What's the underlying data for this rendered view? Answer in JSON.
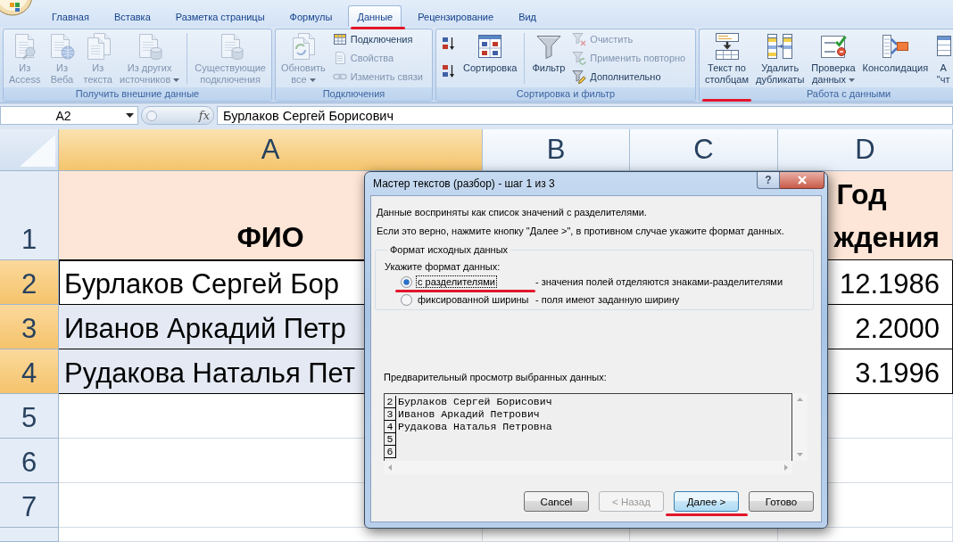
{
  "tabs": [
    {
      "label": "Главная",
      "selected": false,
      "marked": false
    },
    {
      "label": "Вставка",
      "selected": false,
      "marked": false
    },
    {
      "label": "Разметка страницы",
      "selected": false,
      "marked": false
    },
    {
      "label": "Формулы",
      "selected": false,
      "marked": false
    },
    {
      "label": "Данные",
      "selected": true,
      "marked": true
    },
    {
      "label": "Рецензирование",
      "selected": false,
      "marked": false
    },
    {
      "label": "Вид",
      "selected": false,
      "marked": false
    }
  ],
  "ribbon_groups": [
    {
      "title": "Получить внешние данные",
      "items": [
        {
          "kind": "large",
          "label": [
            "Из",
            "Access"
          ],
          "disabled": true,
          "dropdown": false,
          "marked": false
        },
        {
          "kind": "large",
          "label": [
            "Из",
            "Веба"
          ],
          "disabled": true,
          "dropdown": false,
          "marked": false
        },
        {
          "kind": "large",
          "label": [
            "Из",
            "текста"
          ],
          "disabled": true,
          "dropdown": false,
          "marked": false
        },
        {
          "kind": "large",
          "label": [
            "Из других",
            "источников"
          ],
          "disabled": true,
          "dropdown": true,
          "marked": false
        },
        {
          "kind": "separator"
        },
        {
          "kind": "large",
          "label": [
            "Существующие",
            "подключения"
          ],
          "disabled": true,
          "dropdown": false,
          "marked": false
        }
      ]
    },
    {
      "title": "Подключения",
      "items": [
        {
          "kind": "large",
          "label": [
            "Обновить",
            "все"
          ],
          "disabled": true,
          "dropdown": true,
          "marked": false
        },
        {
          "kind": "small",
          "label": [
            "Подключения"
          ],
          "disabled": false,
          "dropdown": false,
          "marked": false
        },
        {
          "kind": "small",
          "label": [
            "Свойства"
          ],
          "disabled": true,
          "dropdown": false,
          "marked": false
        },
        {
          "kind": "small",
          "label": [
            "Изменить связи"
          ],
          "disabled": true,
          "dropdown": false,
          "marked": false
        }
      ]
    },
    {
      "title": "Сортировка и фильтр",
      "items": [
        {
          "kind": "small",
          "disabled": false,
          "dropdown": false,
          "marked": false
        },
        {
          "kind": "small",
          "disabled": false,
          "dropdown": false,
          "marked": false
        },
        {
          "kind": "large",
          "label": [
            "Сортировка"
          ],
          "disabled": false,
          "dropdown": false,
          "marked": false
        },
        {
          "kind": "separator"
        },
        {
          "kind": "large",
          "label": [
            "Фильтр"
          ],
          "disabled": false,
          "dropdown": false,
          "marked": false
        },
        {
          "kind": "small",
          "label": [
            "Очистить"
          ],
          "disabled": true,
          "dropdown": false,
          "marked": false
        },
        {
          "kind": "small",
          "label": [
            "Применить повторно"
          ],
          "disabled": true,
          "dropdown": false,
          "marked": false
        },
        {
          "kind": "small",
          "label": [
            "Дополнительно"
          ],
          "disabled": false,
          "dropdown": false,
          "marked": false
        }
      ]
    },
    {
      "title": "Работа с данными",
      "items": [
        {
          "kind": "large",
          "label": [
            "Текст по",
            "столбцам"
          ],
          "disabled": false,
          "dropdown": false,
          "marked": true
        },
        {
          "kind": "large",
          "label": [
            "Удалить",
            "дубликаты"
          ],
          "disabled": false,
          "dropdown": false,
          "marked": false
        },
        {
          "kind": "large",
          "label": [
            "Проверка",
            "данных"
          ],
          "disabled": false,
          "dropdown": true,
          "marked": false
        },
        {
          "kind": "large",
          "label": [
            "Консолидация"
          ],
          "disabled": false,
          "dropdown": false,
          "marked": false
        },
        {
          "kind": "large",
          "label": [
            "А",
            "\"чт"
          ],
          "disabled": false,
          "dropdown": false,
          "marked": false
        }
      ]
    }
  ],
  "formula_bar": {
    "cell_ref": "A2",
    "function_button": "fx",
    "value": "Бурлаков Сергей Борисович"
  },
  "sheet": {
    "columns": [
      {
        "label": "A",
        "selected": true
      },
      {
        "label": "B",
        "selected": false
      },
      {
        "label": "C",
        "selected": false
      },
      {
        "label": "D",
        "selected": false
      }
    ],
    "rows": [
      {
        "label": "1",
        "selected": false,
        "kind": "header",
        "cells": [
          {
            "lines": [
              "ФИО"
            ],
            "selected": false,
            "active": false
          },
          null,
          null,
          {
            "lines": [
              "Год",
              "ждения"
            ],
            "selected": false,
            "active": false
          }
        ]
      },
      {
        "label": "2",
        "selected": true,
        "kind": "data",
        "cells": [
          {
            "lines": [
              "Бурлаков Сергей Бор"
            ],
            "selected": false,
            "active": true
          },
          null,
          null,
          {
            "lines": [
              "12.1986"
            ],
            "selected": false,
            "active": false
          }
        ]
      },
      {
        "label": "3",
        "selected": true,
        "kind": "data",
        "cells": [
          {
            "lines": [
              "Иванов Аркадий Петр"
            ],
            "selected": true,
            "active": false
          },
          null,
          null,
          {
            "lines": [
              "2.2000"
            ],
            "selected": false,
            "active": false
          }
        ]
      },
      {
        "label": "4",
        "selected": true,
        "kind": "data",
        "cells": [
          {
            "lines": [
              "Рудакова Наталья Пет"
            ],
            "selected": true,
            "active": false
          },
          null,
          null,
          {
            "lines": [
              "3.1996"
            ],
            "selected": false,
            "active": false
          }
        ]
      },
      {
        "label": "5",
        "selected": false,
        "kind": "empty"
      },
      {
        "label": "6",
        "selected": false,
        "kind": "empty"
      },
      {
        "label": "7",
        "selected": false,
        "kind": "empty"
      },
      {
        "selected": false,
        "kind": "empty"
      }
    ]
  },
  "dialog": {
    "title": "Мастер текстов (разбор) - шаг 1 из 3",
    "help_label": "?",
    "intro": [
      "Данные восприняты как список значений с разделителями.",
      "Если это верно, нажмите кнопку \"Далее >\", в противном случае укажите формат данных."
    ],
    "format": {
      "legend": "Формат исходных данных",
      "prompt": "Укажите формат данных:",
      "options": [
        {
          "label": "с разделителями",
          "description": "- значения полей отделяются знаками-разделителями",
          "selected": true,
          "marked": true
        },
        {
          "label": "фиксированной ширины",
          "description": "- поля имеют заданную ширину",
          "selected": false,
          "marked": false
        }
      ]
    },
    "preview": {
      "label": "Предварительный просмотр выбранных данных:",
      "rows": [
        {
          "number": "2",
          "text": "Бурлаков Сергей Борисович"
        },
        {
          "number": "3",
          "text": "Иванов Аркадий Петрович"
        },
        {
          "number": "4",
          "text": "Рудакова Наталья Петровна"
        },
        {
          "number": "5"
        },
        {
          "number": "6"
        }
      ]
    },
    "buttons": [
      {
        "label": "Cancel",
        "disabled": false,
        "default": false,
        "marked": false
      },
      {
        "label": "< Назад",
        "disabled": true,
        "default": false,
        "marked": false
      },
      {
        "label": "Далее >",
        "disabled": false,
        "default": true,
        "marked": true
      },
      {
        "label": "Готово",
        "disabled": false,
        "default": false,
        "marked": false
      }
    ]
  }
}
